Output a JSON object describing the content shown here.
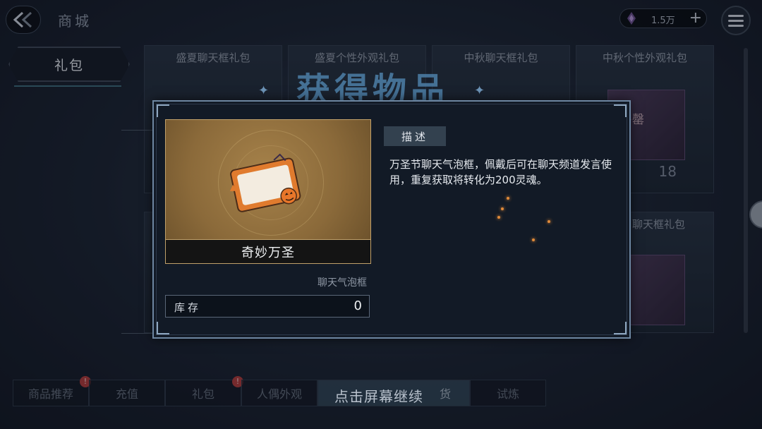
{
  "header": {
    "title": "商城",
    "currency_value": "1.5万",
    "plus_label": "+"
  },
  "sidebar": {
    "category_label": "礼包"
  },
  "cards": [
    {
      "name": "盛夏聊天框礼包"
    },
    {
      "name": "盛夏个性外观礼包"
    },
    {
      "name": "中秋聊天框礼包"
    },
    {
      "name": "中秋个性外观礼包",
      "tag": "售罄",
      "count": "18"
    },
    {
      "name": "聊天框礼包"
    }
  ],
  "overlay": {
    "title": "获得物品",
    "continue_hint": "点击屏幕继续"
  },
  "dialog": {
    "item_name": "奇妙万圣",
    "item_type": "聊天气泡框",
    "stock_label": "库存",
    "stock_value": "0",
    "desc_tab": "描述",
    "description": "万圣节聊天气泡框，佩戴后可在聊天频道发言使用，重复获取将转化为200灵魂。"
  },
  "tabs": [
    {
      "label": "商品推荐",
      "badge": "!"
    },
    {
      "label": "充值"
    },
    {
      "label": "礼包",
      "badge": "!"
    },
    {
      "label": "人偶外观"
    },
    {
      "label": "货"
    },
    {
      "label": "试炼"
    }
  ],
  "colors": {
    "dialog_border": "#6d86a1",
    "item_bg": "#8b6a3a",
    "title_blue": "#4d7fa8",
    "badge_red": "#b03b3b"
  }
}
